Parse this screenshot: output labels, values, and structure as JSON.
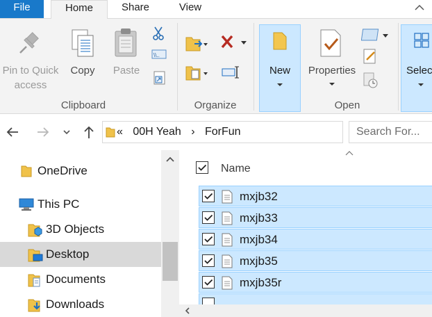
{
  "ribbon_tabs": {
    "file": "File",
    "home": "Home",
    "share": "Share",
    "view": "View"
  },
  "ribbon": {
    "pin": {
      "line1": "Pin to Quick",
      "line2": "access"
    },
    "copy": "Copy",
    "paste": "Paste",
    "clipboard_group": "Clipboard",
    "organize_group": "Organize",
    "new": "New",
    "properties": "Properties",
    "open_group": "Open",
    "select": "Select"
  },
  "navbar": {
    "path_prefix": "«",
    "path_parts": [
      "00H Yeah",
      "ForFun"
    ],
    "separator": "›",
    "search_placeholder": "Search For..."
  },
  "nav_pane": {
    "items": [
      {
        "label": "OneDrive",
        "icon": "folder-yellow-icon"
      },
      {
        "label": "This PC",
        "icon": "computer-icon"
      },
      {
        "label": "3D Objects",
        "icon": "3d-objects-icon"
      },
      {
        "label": "Desktop",
        "icon": "desktop-folder-icon",
        "selected": true
      },
      {
        "label": "Documents",
        "icon": "documents-folder-icon"
      },
      {
        "label": "Downloads",
        "icon": "downloads-folder-icon"
      }
    ]
  },
  "files": {
    "column_name": "Name",
    "rows": [
      {
        "name": "mxjb32",
        "checked": true
      },
      {
        "name": "mxjb33",
        "checked": true
      },
      {
        "name": "mxjb34",
        "checked": true
      },
      {
        "name": "mxjb35",
        "checked": true
      },
      {
        "name": "mxjb35r",
        "checked": true
      }
    ]
  },
  "colors": {
    "accent": "#1979ca",
    "selection": "#cce8ff",
    "selection_border": "#99d1ff",
    "ribbon_bg": "#f3f3f3"
  }
}
